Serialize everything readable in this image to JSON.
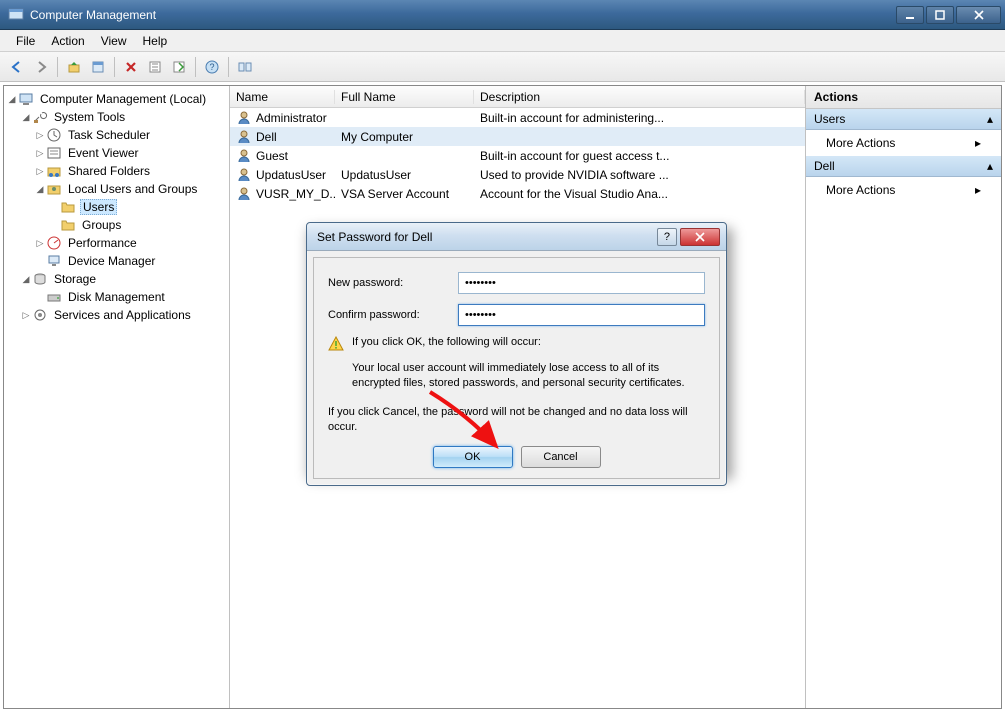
{
  "window": {
    "title": "Computer Management"
  },
  "menu": {
    "file": "File",
    "action": "Action",
    "view": "View",
    "help": "Help"
  },
  "tree": {
    "root": "Computer Management (Local)",
    "system_tools": "System Tools",
    "task_scheduler": "Task Scheduler",
    "event_viewer": "Event Viewer",
    "shared_folders": "Shared Folders",
    "local_users": "Local Users and Groups",
    "users": "Users",
    "groups": "Groups",
    "performance": "Performance",
    "device_manager": "Device Manager",
    "storage": "Storage",
    "disk_management": "Disk Management",
    "services": "Services and Applications"
  },
  "list": {
    "hdr_name": "Name",
    "hdr_full": "Full Name",
    "hdr_desc": "Description",
    "rows": [
      {
        "name": "Administrator",
        "full": "",
        "desc": "Built-in account for administering..."
      },
      {
        "name": "Dell",
        "full": "My Computer",
        "desc": ""
      },
      {
        "name": "Guest",
        "full": "",
        "desc": "Built-in account for guest access t..."
      },
      {
        "name": "UpdatusUser",
        "full": "UpdatusUser",
        "desc": "Used to provide NVIDIA software ..."
      },
      {
        "name": "VUSR_MY_D...",
        "full": "VSA Server Account",
        "desc": "Account for the Visual Studio Ana..."
      }
    ]
  },
  "actions": {
    "header": "Actions",
    "sec1": "Users",
    "sec2": "Dell",
    "more": "More Actions"
  },
  "dialog": {
    "title": "Set Password for Dell",
    "new_label": "New password:",
    "confirm_label": "Confirm password:",
    "new_value": "••••••••",
    "confirm_value": "••••••••",
    "warn_heading": "If you click OK, the following will occur:",
    "warn_body": "Your local user account will immediately lose access to all of its encrypted files, stored passwords, and personal security certificates.",
    "cancel_body": "If you click Cancel, the password will not be changed and no data loss will occur.",
    "ok": "OK",
    "cancel": "Cancel"
  }
}
